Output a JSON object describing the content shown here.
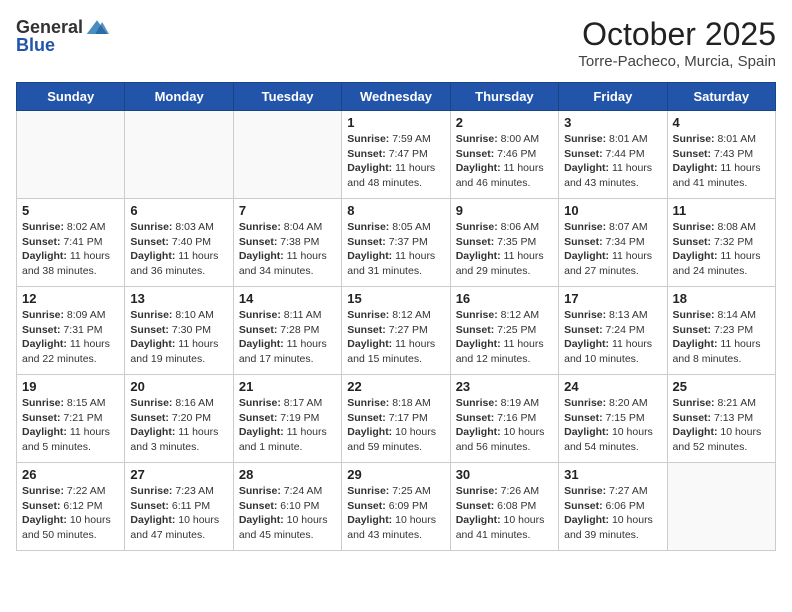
{
  "header": {
    "logo_general": "General",
    "logo_blue": "Blue",
    "month": "October 2025",
    "location": "Torre-Pacheco, Murcia, Spain"
  },
  "days_of_week": [
    "Sunday",
    "Monday",
    "Tuesday",
    "Wednesday",
    "Thursday",
    "Friday",
    "Saturday"
  ],
  "weeks": [
    [
      {
        "day": "",
        "info": ""
      },
      {
        "day": "",
        "info": ""
      },
      {
        "day": "",
        "info": ""
      },
      {
        "day": "1",
        "info": "Sunrise: 7:59 AM\nSunset: 7:47 PM\nDaylight: 11 hours and 48 minutes."
      },
      {
        "day": "2",
        "info": "Sunrise: 8:00 AM\nSunset: 7:46 PM\nDaylight: 11 hours and 46 minutes."
      },
      {
        "day": "3",
        "info": "Sunrise: 8:01 AM\nSunset: 7:44 PM\nDaylight: 11 hours and 43 minutes."
      },
      {
        "day": "4",
        "info": "Sunrise: 8:01 AM\nSunset: 7:43 PM\nDaylight: 11 hours and 41 minutes."
      }
    ],
    [
      {
        "day": "5",
        "info": "Sunrise: 8:02 AM\nSunset: 7:41 PM\nDaylight: 11 hours and 38 minutes."
      },
      {
        "day": "6",
        "info": "Sunrise: 8:03 AM\nSunset: 7:40 PM\nDaylight: 11 hours and 36 minutes."
      },
      {
        "day": "7",
        "info": "Sunrise: 8:04 AM\nSunset: 7:38 PM\nDaylight: 11 hours and 34 minutes."
      },
      {
        "day": "8",
        "info": "Sunrise: 8:05 AM\nSunset: 7:37 PM\nDaylight: 11 hours and 31 minutes."
      },
      {
        "day": "9",
        "info": "Sunrise: 8:06 AM\nSunset: 7:35 PM\nDaylight: 11 hours and 29 minutes."
      },
      {
        "day": "10",
        "info": "Sunrise: 8:07 AM\nSunset: 7:34 PM\nDaylight: 11 hours and 27 minutes."
      },
      {
        "day": "11",
        "info": "Sunrise: 8:08 AM\nSunset: 7:32 PM\nDaylight: 11 hours and 24 minutes."
      }
    ],
    [
      {
        "day": "12",
        "info": "Sunrise: 8:09 AM\nSunset: 7:31 PM\nDaylight: 11 hours and 22 minutes."
      },
      {
        "day": "13",
        "info": "Sunrise: 8:10 AM\nSunset: 7:30 PM\nDaylight: 11 hours and 19 minutes."
      },
      {
        "day": "14",
        "info": "Sunrise: 8:11 AM\nSunset: 7:28 PM\nDaylight: 11 hours and 17 minutes."
      },
      {
        "day": "15",
        "info": "Sunrise: 8:12 AM\nSunset: 7:27 PM\nDaylight: 11 hours and 15 minutes."
      },
      {
        "day": "16",
        "info": "Sunrise: 8:12 AM\nSunset: 7:25 PM\nDaylight: 11 hours and 12 minutes."
      },
      {
        "day": "17",
        "info": "Sunrise: 8:13 AM\nSunset: 7:24 PM\nDaylight: 11 hours and 10 minutes."
      },
      {
        "day": "18",
        "info": "Sunrise: 8:14 AM\nSunset: 7:23 PM\nDaylight: 11 hours and 8 minutes."
      }
    ],
    [
      {
        "day": "19",
        "info": "Sunrise: 8:15 AM\nSunset: 7:21 PM\nDaylight: 11 hours and 5 minutes."
      },
      {
        "day": "20",
        "info": "Sunrise: 8:16 AM\nSunset: 7:20 PM\nDaylight: 11 hours and 3 minutes."
      },
      {
        "day": "21",
        "info": "Sunrise: 8:17 AM\nSunset: 7:19 PM\nDaylight: 11 hours and 1 minute."
      },
      {
        "day": "22",
        "info": "Sunrise: 8:18 AM\nSunset: 7:17 PM\nDaylight: 10 hours and 59 minutes."
      },
      {
        "day": "23",
        "info": "Sunrise: 8:19 AM\nSunset: 7:16 PM\nDaylight: 10 hours and 56 minutes."
      },
      {
        "day": "24",
        "info": "Sunrise: 8:20 AM\nSunset: 7:15 PM\nDaylight: 10 hours and 54 minutes."
      },
      {
        "day": "25",
        "info": "Sunrise: 8:21 AM\nSunset: 7:13 PM\nDaylight: 10 hours and 52 minutes."
      }
    ],
    [
      {
        "day": "26",
        "info": "Sunrise: 7:22 AM\nSunset: 6:12 PM\nDaylight: 10 hours and 50 minutes."
      },
      {
        "day": "27",
        "info": "Sunrise: 7:23 AM\nSunset: 6:11 PM\nDaylight: 10 hours and 47 minutes."
      },
      {
        "day": "28",
        "info": "Sunrise: 7:24 AM\nSunset: 6:10 PM\nDaylight: 10 hours and 45 minutes."
      },
      {
        "day": "29",
        "info": "Sunrise: 7:25 AM\nSunset: 6:09 PM\nDaylight: 10 hours and 43 minutes."
      },
      {
        "day": "30",
        "info": "Sunrise: 7:26 AM\nSunset: 6:08 PM\nDaylight: 10 hours and 41 minutes."
      },
      {
        "day": "31",
        "info": "Sunrise: 7:27 AM\nSunset: 6:06 PM\nDaylight: 10 hours and 39 minutes."
      },
      {
        "day": "",
        "info": ""
      }
    ]
  ]
}
